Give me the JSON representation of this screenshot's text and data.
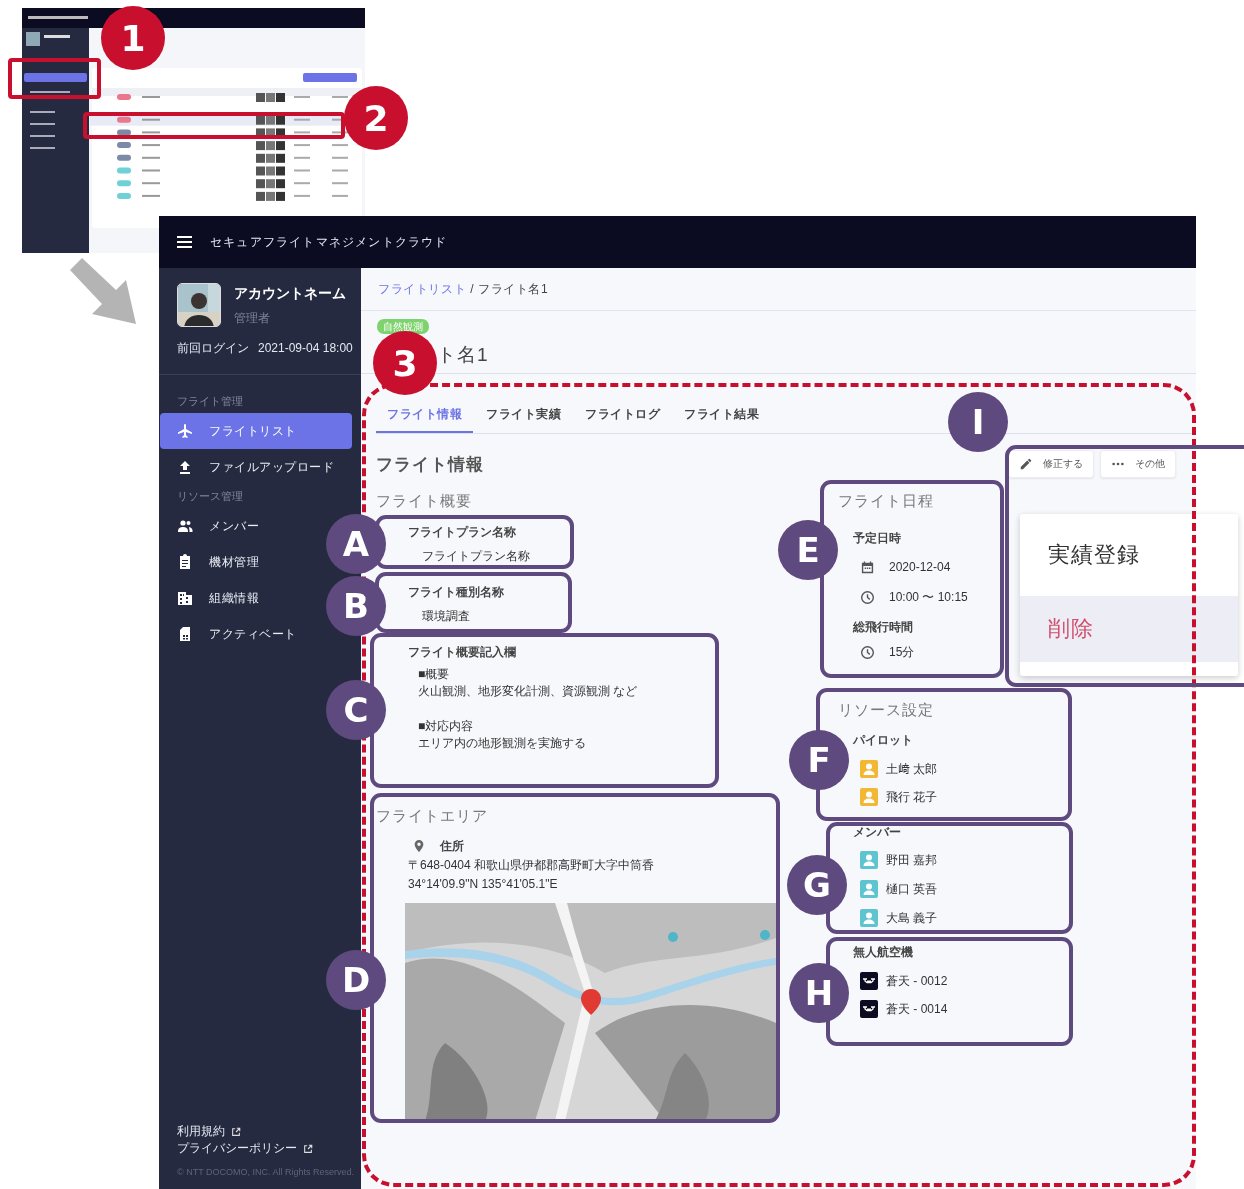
{
  "app": {
    "title": "セキュアフライトマネジメントクラウド"
  },
  "account": {
    "name": "アカウントネーム",
    "role": "管理者",
    "last_login_label": "前回ログイン",
    "last_login": "2021-09-04 18:00"
  },
  "sidebar": {
    "sections": [
      {
        "heading": "フライト管理",
        "items": [
          {
            "label": "フライトリスト",
            "selected": true
          },
          {
            "label": "ファイルアップロード",
            "selected": false
          }
        ]
      },
      {
        "heading": "リソース管理",
        "items": [
          {
            "label": "メンバー",
            "selected": false
          },
          {
            "label": "機材管理",
            "selected": false
          },
          {
            "label": "組織情報",
            "selected": false
          },
          {
            "label": "アクティベート",
            "selected": false
          }
        ]
      }
    ],
    "footer_links": [
      "利用規約",
      "プライバシーポリシー"
    ],
    "copyright": "© NTT DOCOMO, INC. All Rights Reserved."
  },
  "breadcrumb": {
    "separator": "/",
    "items": [
      {
        "label": "フライトリスト",
        "link": true
      },
      {
        "label": "フライト名1",
        "link": false
      }
    ]
  },
  "flight": {
    "tag": "自然観測",
    "title": "ト名1"
  },
  "tabs": [
    {
      "label": "フライト情報",
      "selected": true
    },
    {
      "label": "フライト実績",
      "selected": false
    },
    {
      "label": "フライトログ",
      "selected": false
    },
    {
      "label": "フライト結果",
      "selected": false
    }
  ],
  "section_title": "フライト情報",
  "actions": [
    "修正する",
    "その他"
  ],
  "menu": [
    {
      "label": "実績登録",
      "kind": "normal",
      "highlighted": false
    },
    {
      "label": "削除",
      "kind": "danger",
      "highlighted": true
    }
  ],
  "overview": {
    "title": "フライト概要",
    "fields": [
      {
        "label": "フライトプラン名称",
        "value": "フライトプラン名称"
      },
      {
        "label": "フライト種別名称",
        "value": "環境調査"
      }
    ],
    "notes": {
      "label": "フライト概要記入欄",
      "paragraphs": [
        {
          "heading": "■概要",
          "text": "火山観測、地形変化計測、資源観測 など"
        },
        {
          "heading": "■対応内容",
          "text": "エリア内の地形観測を実施する"
        }
      ]
    }
  },
  "area": {
    "title": "フライトエリア",
    "address_label": "住所",
    "address": "〒648-0404 和歌山県伊都郡高野町大字中筒香",
    "coordinates": "34°14'09.9\"N 135°41'05.1\"E"
  },
  "schedule": {
    "title": "フライト日程",
    "groups": [
      {
        "label": "予定日時",
        "rows": [
          {
            "kind": "date",
            "text": "2020-12-04"
          },
          {
            "kind": "time",
            "text": "10:00 〜 10:15"
          }
        ]
      },
      {
        "label": "総飛行時間",
        "rows": [
          {
            "kind": "time",
            "text": "15分"
          }
        ]
      }
    ]
  },
  "resources": {
    "title": "リソース設定",
    "groups": [
      {
        "label": "パイロット",
        "kind": "pilot",
        "items": [
          "土﨑 太郎",
          "飛行 花子"
        ]
      },
      {
        "label": "メンバー",
        "kind": "member",
        "items": [
          "野田 嘉邦",
          "樋口 英吾",
          "大島 義子"
        ]
      },
      {
        "label": "無人航空機",
        "kind": "drone",
        "items": [
          "蒼天 - 0012",
          "蒼天 - 0014"
        ]
      }
    ]
  },
  "annotations": {
    "steps": [
      "1",
      "2",
      "3"
    ],
    "callouts": [
      "A",
      "B",
      "C",
      "D",
      "E",
      "F",
      "G",
      "H",
      "I"
    ]
  }
}
